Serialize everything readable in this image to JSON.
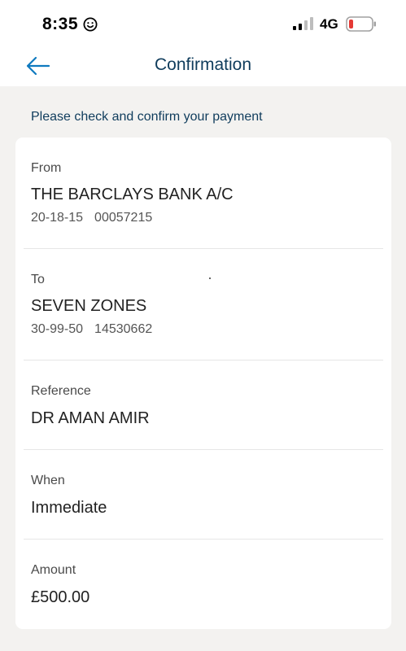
{
  "status_bar": {
    "time": "8:35",
    "network": "4G",
    "icons": [
      "smiley-icon",
      "signal-icon",
      "battery-icon"
    ],
    "battery_color": "#e53935"
  },
  "header": {
    "title": "Confirmation",
    "back_icon": "arrow-left-icon",
    "accent_color": "#0f7abf"
  },
  "instruction": "Please check and confirm your payment",
  "from": {
    "label": "From",
    "name": "THE BARCLAYS BANK A/C",
    "sort_code": "20-18-15",
    "account_number": "00057215"
  },
  "to": {
    "label": "To",
    "name": "SEVEN ZONES",
    "sort_code": "30-99-50",
    "account_number": "14530662"
  },
  "reference": {
    "label": "Reference",
    "value": "DR AMAN AMIR"
  },
  "when": {
    "label": "When",
    "value": "Immediate"
  },
  "amount": {
    "label": "Amount",
    "value": "£500.00"
  }
}
